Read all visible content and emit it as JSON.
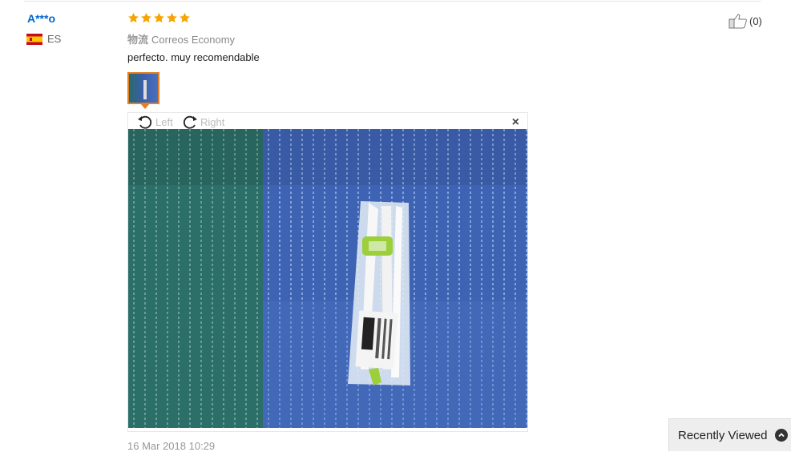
{
  "review": {
    "user": "A***o",
    "country_code": "ES",
    "rating": 5,
    "logistics_label": "物流",
    "logistics_value": "Correos Economy",
    "text": "perfecto. muy recomendable",
    "likes": "(0)",
    "date": "16 Mar 2018 10:29"
  },
  "viewer": {
    "rotate_left": "Left",
    "rotate_right": "Right",
    "close": "×"
  },
  "recently_viewed": {
    "label": "Recently Viewed"
  },
  "colors": {
    "star": "#f7a400",
    "username": "#0066cc",
    "thumb_border": "#e67e22"
  }
}
